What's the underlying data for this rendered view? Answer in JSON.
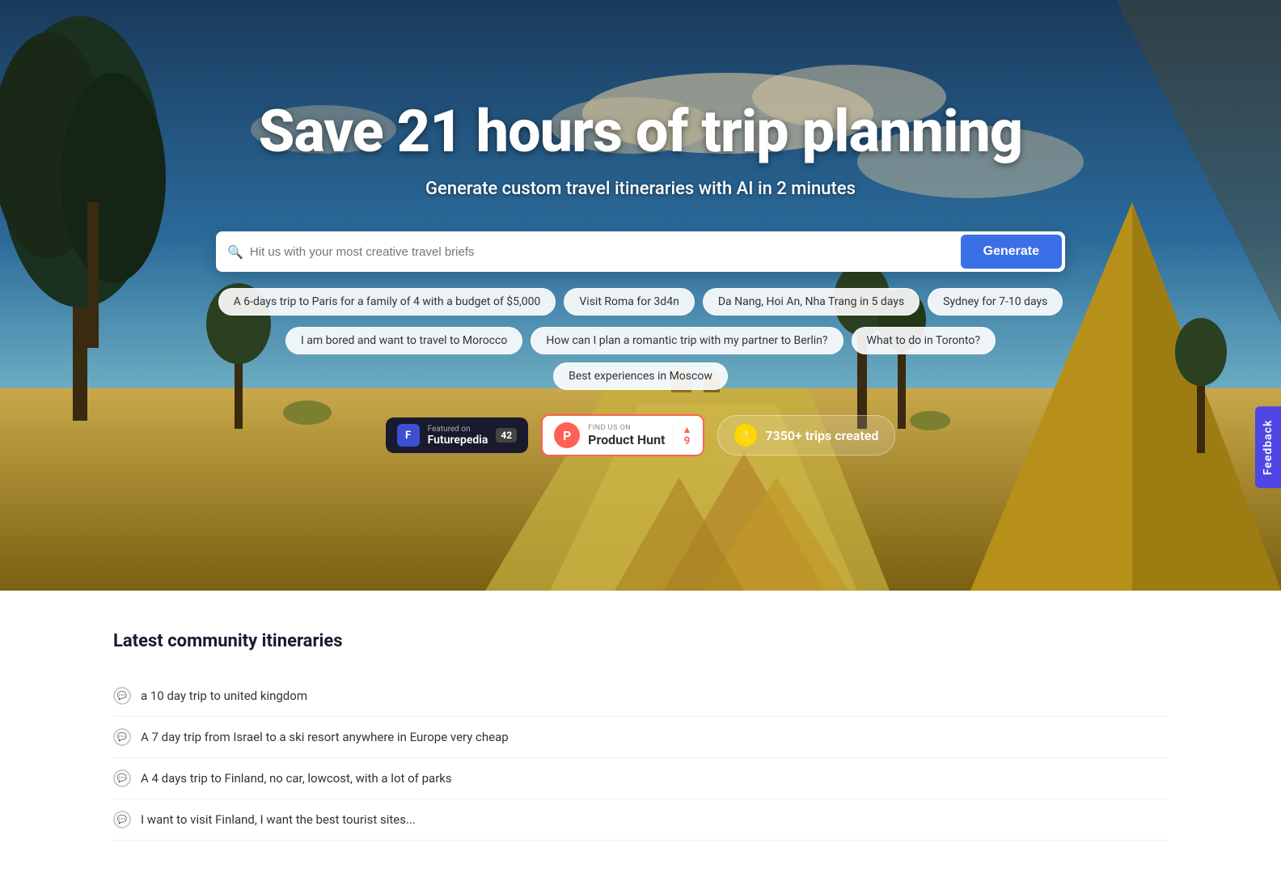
{
  "hero": {
    "title": "Save 21 hours of trip planning",
    "subtitle": "Generate custom travel itineraries with AI in 2 minutes",
    "search_placeholder": "Hit us with your most creative travel briefs",
    "generate_label": "Generate",
    "tags_row1": [
      "A 6-days trip to Paris for a family of 4 with a budget of $5,000",
      "Visit Roma for 3d4n",
      "Da Nang, Hoi An, Nha Trang in 5 days",
      "Sydney for 7-10 days"
    ],
    "tags_row2": [
      "I am bored and want to travel to Morocco",
      "How can I plan a romantic trip with my partner to Berlin?",
      "What to do in Toronto?",
      "Best experiences in Moscow"
    ]
  },
  "badges": {
    "futurepedia": {
      "icon_label": "F",
      "featured_text": "Featured on",
      "name": "Futurepedia",
      "count": "42"
    },
    "product_hunt": {
      "find_us_label": "FIND US ON",
      "name": "Product Hunt",
      "votes": "9",
      "arrow": "▲"
    },
    "trips": {
      "count_label": "7350+ trips created"
    }
  },
  "feedback": {
    "label": "Feedback"
  },
  "community": {
    "title": "Latest community itineraries",
    "items": [
      "a 10 day trip to united kingdom",
      "A 7 day trip from Israel to a ski resort anywhere in Europe very cheap",
      "A 4 days trip to Finland, no car, lowcost, with a lot of parks",
      "I want to visit Finland, I want the best tourist sites..."
    ]
  }
}
